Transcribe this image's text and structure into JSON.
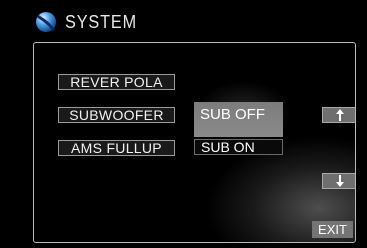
{
  "header": {
    "title": "SYSTEM",
    "icon": "system-globe-icon"
  },
  "menu": {
    "items": [
      {
        "label": "REVER POLA"
      },
      {
        "label": "SUBWOOFER"
      },
      {
        "label": "AMS FULLUP"
      }
    ]
  },
  "subwoofer_options": {
    "selected": "SUB OFF",
    "options": [
      {
        "label": "SUB OFF",
        "highlighted": true
      },
      {
        "label": "SUB ON",
        "highlighted": false
      }
    ]
  },
  "navigation": {
    "up_icon": "arrow-up-icon",
    "down_icon": "arrow-down-icon",
    "exit_label": "EXIT"
  },
  "colors": {
    "background": "#000000",
    "panel_border": "#b9b9b9",
    "highlight": "#8a8a8a",
    "text": "#ffffff"
  }
}
